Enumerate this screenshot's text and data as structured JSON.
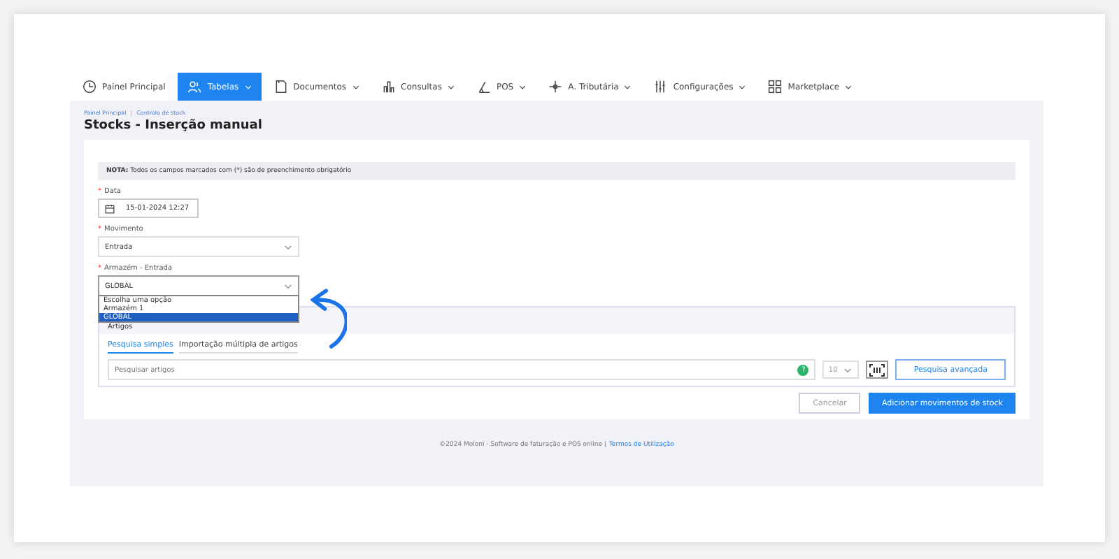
{
  "nav": [
    {
      "label": "Painel Principal",
      "dropdown": false,
      "selected": false
    },
    {
      "label": "Tabelas",
      "dropdown": true,
      "selected": true
    },
    {
      "label": "Documentos",
      "dropdown": true,
      "selected": false
    },
    {
      "label": "Consultas",
      "dropdown": true,
      "selected": false
    },
    {
      "label": "POS",
      "dropdown": true,
      "selected": false
    },
    {
      "label": "A. Tributária",
      "dropdown": true,
      "selected": false
    },
    {
      "label": "Configurações",
      "dropdown": true,
      "selected": false
    },
    {
      "label": "Marketplace",
      "dropdown": true,
      "selected": false
    }
  ],
  "breadcrumb": {
    "items": [
      "Painel Principal",
      "Controlo de stock"
    ],
    "separator": "|"
  },
  "title": "Stocks - Inserção manual",
  "note": "**NOTA:** Todos os campos marcados com (*) são de preenchimento obrigatório",
  "fields": [
    {
      "label": "Data",
      "required_mark": "*",
      "kind": "date",
      "value": "15-01-2024 12:27"
    },
    {
      "label": "Movimento",
      "required_mark": "*",
      "kind": "select",
      "value": "Entrada"
    },
    {
      "label": "Armazém - Entrada",
      "required_mark": "*",
      "kind": "select",
      "value": "GLOBAL",
      "expanded": true,
      "options": [
        {
          "label": "Escolha uma opção",
          "selected": false
        },
        {
          "label": "Armazém 1",
          "selected": false
        },
        {
          "label": "GLOBAL",
          "selected": true
        }
      ]
    }
  ],
  "articles": {
    "title": "Artigos",
    "tabs": [
      {
        "label": "Pesquisa simples",
        "selected": true
      },
      {
        "label": "Importação múltipla de artigos",
        "selected": false
      }
    ],
    "search": {
      "placeholder": "Pesquisar artigos"
    },
    "help": "?",
    "page_size": "10",
    "advanced": "Pesquisa avançada"
  },
  "buttons": {
    "cancel": "Cancelar",
    "submit": "Adicionar movimentos de stock"
  },
  "footer": {
    "text": "©2024 Moloni - Software de faturação e POS online |",
    "link": "Termos de Utilização"
  }
}
